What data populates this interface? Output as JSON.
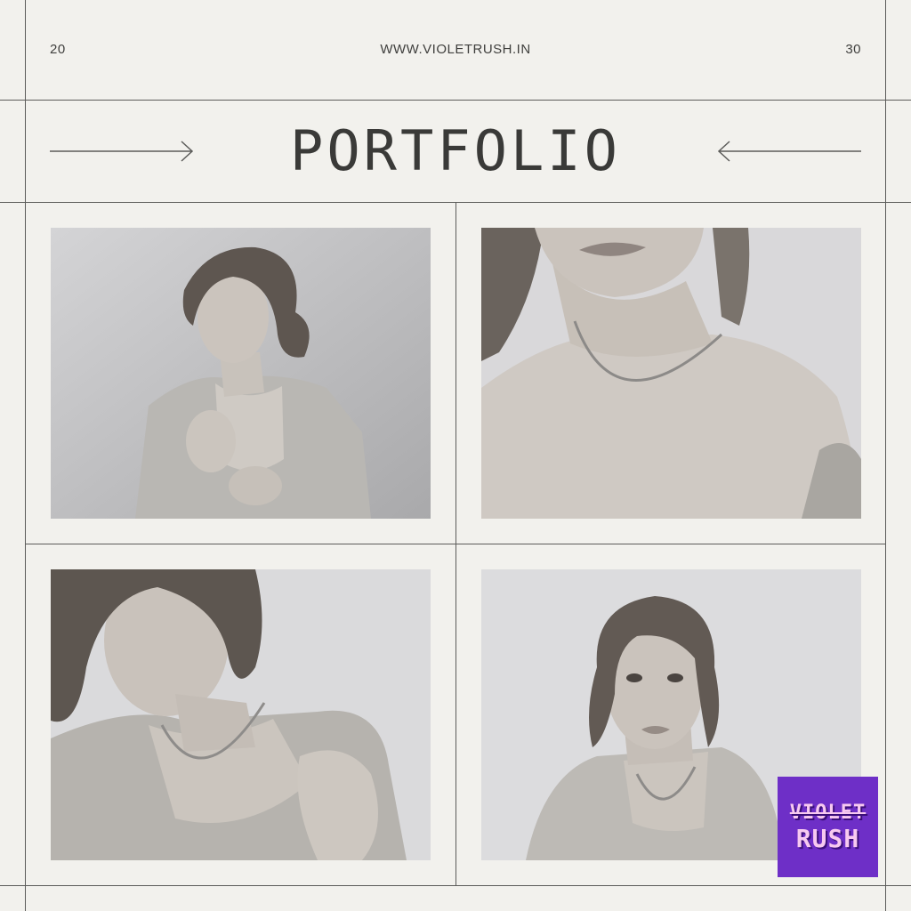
{
  "header": {
    "left_number": "20",
    "website": "WWW.VIOLETRUSH.IN",
    "right_number": "30"
  },
  "title": "PORTFOLIO",
  "photos": [
    {
      "description_icon": "portrait-photo"
    },
    {
      "description_icon": "portrait-photo"
    },
    {
      "description_icon": "portrait-photo"
    },
    {
      "description_icon": "portrait-photo"
    }
  ],
  "logo": {
    "line1": "VIOLET",
    "line2": "RUSH",
    "background_color": "#6e2fc7",
    "text_color": "#f7c9f0"
  },
  "colors": {
    "background": "#f2f1ed",
    "lines": "#5c5c5a",
    "text": "#3f3f3d"
  }
}
